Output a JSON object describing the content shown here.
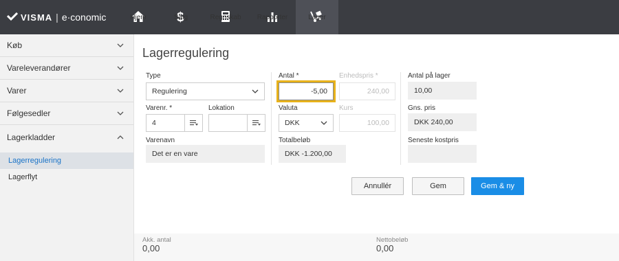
{
  "header": {
    "brand": "VISMA",
    "separator": "|",
    "product": "e·conomic",
    "nav": [
      {
        "label": "Hjem",
        "icon": "home-icon"
      },
      {
        "label": "Salg",
        "icon": "dollar-icon"
      },
      {
        "label": "Regnskab",
        "icon": "calculator-icon"
      },
      {
        "label": "Rapporter",
        "icon": "bar-chart-icon"
      },
      {
        "label": "Lager",
        "icon": "cart-icon",
        "active": true
      }
    ]
  },
  "sidebar": {
    "sections": [
      {
        "label": "Køb"
      },
      {
        "label": "Vareleverandører"
      },
      {
        "label": "Varer"
      },
      {
        "label": "Følgesedler"
      },
      {
        "label": "Lagerkladder",
        "expanded": true
      }
    ],
    "subitems": [
      {
        "label": "Lagerregulering",
        "active": true
      },
      {
        "label": "Lagerflyt"
      }
    ]
  },
  "form": {
    "title": "Lagerregulering",
    "type_label": "Type",
    "type_value": "Regulering",
    "varenr_label": "Varenr. *",
    "varenr_value": "4",
    "lokation_label": "Lokation",
    "lokation_value": "",
    "varenavn_label": "Varenavn",
    "varenavn_value": "Det er en vare",
    "antal_label": "Antal *",
    "antal_value": "-5,00",
    "enhedspris_label": "Enhedspris *",
    "enhedspris_value": "240,00",
    "valuta_label": "Valuta",
    "valuta_value": "DKK",
    "kurs_label": "Kurs",
    "kurs_value": "100,00",
    "totalbeloeb_label": "Totalbeløb",
    "totalbeloeb_value": "DKK -1.200,00",
    "antal_lager_label": "Antal på lager",
    "antal_lager_value": "10,00",
    "gns_pris_label": "Gns. pris",
    "gns_pris_value": "DKK 240,00",
    "seneste_label": "Seneste kostpris",
    "seneste_value": ""
  },
  "buttons": {
    "cancel": "Annullér",
    "save": "Gem",
    "save_new": "Gem & ny"
  },
  "footer": {
    "akk_label": "Akk. antal",
    "akk_value": "0,00",
    "netto_label": "Nettobeløb",
    "netto_value": "0,00"
  },
  "colors": {
    "topbar": "#3b3d42",
    "primary": "#1a8de6",
    "highlight": "#e8b21b",
    "active_link": "#1a73c7"
  }
}
